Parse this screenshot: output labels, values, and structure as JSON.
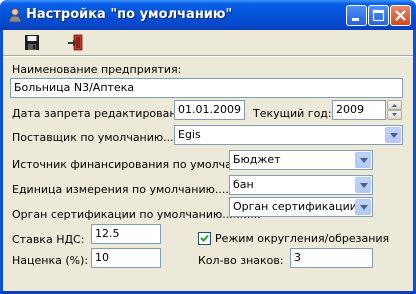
{
  "window": {
    "title": "Настройка \"по умолчанию\"",
    "icon": "user-icon"
  },
  "toolbar": {
    "save_icon": "floppy-disk-icon",
    "exit_icon": "exit-door-icon"
  },
  "form": {
    "enterprise_label": "Наименование предприятия:",
    "enterprise_value": "Больница N3/Аптека",
    "edit_ban_label": "Дата запрета редактирования",
    "edit_ban_value": "01.01.2009",
    "current_year_label": "Текущий год:",
    "current_year_value": "2009",
    "supplier_label": "Поставщик по умолчанию.........",
    "supplier_value": "Egis",
    "funding_label": "Источник финансирования по умолчанию",
    "funding_value": "Бюджет",
    "unit_label": "Единица измерения по умолчанию............",
    "unit_value": "бан",
    "cert_label": "Орган сертификации по умолчанию...........",
    "cert_value": "Орган сертификации",
    "vat_label": "Ставка НДС:",
    "vat_value": "12.5",
    "markup_label": "Наценка (%):",
    "markup_value": "10",
    "rounding_label": "Режим округления/обрезания",
    "rounding_checked": true,
    "digits_label": "Кол-во знаков:",
    "digits_value": "3"
  }
}
